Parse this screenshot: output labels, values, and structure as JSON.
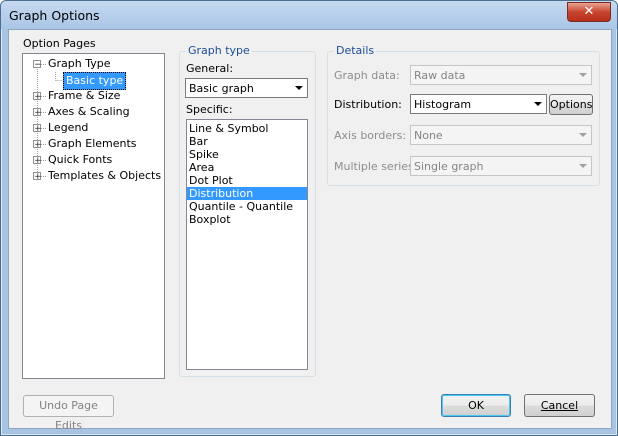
{
  "window": {
    "title": "Graph Options",
    "close_glyph": "✕"
  },
  "option_pages": {
    "label": "Option Pages",
    "items": [
      {
        "label": "Graph Type",
        "expander": "−"
      },
      {
        "label": "Basic type"
      },
      {
        "label": "Frame & Size",
        "expander": "+"
      },
      {
        "label": "Axes & Scaling",
        "expander": "+"
      },
      {
        "label": "Legend",
        "expander": "+"
      },
      {
        "label": "Graph Elements",
        "expander": "+"
      },
      {
        "label": "Quick Fonts",
        "expander": "+"
      },
      {
        "label": "Templates & Objects",
        "expander": "+"
      }
    ]
  },
  "graph_type": {
    "label": "Graph type",
    "general_label": "General:",
    "general_value": "Basic graph",
    "specific_label": "Specific:",
    "specific_items": [
      "Line & Symbol",
      "Bar",
      "Spike",
      "Area",
      "Dot Plot",
      "Distribution",
      "Quantile - Quantile",
      "Boxplot"
    ],
    "selected_index": 5
  },
  "details": {
    "label": "Details",
    "graph_data_label": "Graph data:",
    "graph_data_value": "Raw data",
    "distribution_label": "Distribution:",
    "distribution_value": "Histogram",
    "options_button": "Options",
    "axis_borders_label": "Axis borders:",
    "axis_borders_value": "None",
    "multiple_series_label": "Multiple series:",
    "multiple_series_value": "Single graph"
  },
  "footer": {
    "undo_button": "Undo Page Edits",
    "ok_button": "OK",
    "cancel_button": "Cancel"
  }
}
